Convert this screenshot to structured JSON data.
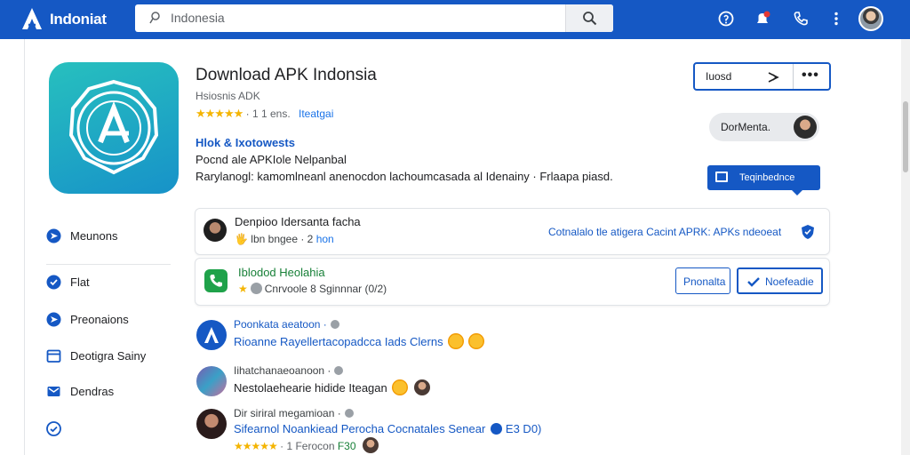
{
  "colors": {
    "brand": "#1558c4",
    "accent": "#1a73e8",
    "star": "#f4b400",
    "green": "#188038"
  },
  "header": {
    "brand": "Indoniat",
    "search_text": "Indonesia",
    "icons": [
      "help-icon",
      "notifications-icon",
      "phone-icon",
      "more-vert-icon"
    ]
  },
  "app": {
    "title": "Download APK Indonsia",
    "subtitle": "Hsiosnis ADK",
    "stars": "★★★★★",
    "rating_text": "· 1 1 ens.",
    "rating_link": "Iteatgai",
    "section_heading": "Hlok & Ixotowests",
    "line1": "Pocnd ale APKIole Nelpanbal",
    "line2": "Rarylanogl: kamomlneanl anenocdon lachoumcasada al Idenainy · Frlaapa piasd."
  },
  "actions": {
    "toolbox_label": "Iuosd",
    "more": "•••",
    "chip_label": "DorMenta.",
    "primary_label": "Teqinbednce"
  },
  "sidebar": {
    "items": [
      {
        "label": "Meunons",
        "icon": "send-icon"
      },
      {
        "label": "Flat",
        "icon": "check-circle-icon"
      },
      {
        "label": "Preonaions",
        "icon": "send-icon"
      },
      {
        "label": "Deotigra Sainy",
        "icon": "calendar-icon"
      },
      {
        "label": "Dendras",
        "icon": "mail-icon"
      },
      {
        "label": "",
        "icon": "check-circle-icon"
      }
    ]
  },
  "cards": [
    {
      "title": "Denpioo Idersanta facha",
      "meta_prefix": "🖐",
      "meta_text": "lbn bngee · 2",
      "meta_link": "hon",
      "right_text": "Cotnalalo tle atigera Cacint APRK: APKs ndeoeat"
    },
    {
      "title": "Iblodod Heolahia",
      "meta_star": "★",
      "meta_text": "Cnrvoole 8 Sginnnar (0/2)",
      "btn_a": "Pnonalta",
      "btn_b": "Noefeadie"
    }
  ],
  "feed": [
    {
      "head": "Poonkata aeatoon ·",
      "body": "Rioanne Rayellertacopadcca Iads Clerns"
    },
    {
      "head": "Iihatchanaeoanoon ·",
      "body": "Nestolaehearie hidide Iteagan"
    },
    {
      "head": "Dir siriral megamioan ·",
      "body": "Sifearnol Noankiead Perocha Cocnatales Senear",
      "body_suffix": "E3 D0)",
      "stars": "★★★★★",
      "stars_text": "· 1 Ferocon",
      "stars_green": "F30"
    }
  ]
}
